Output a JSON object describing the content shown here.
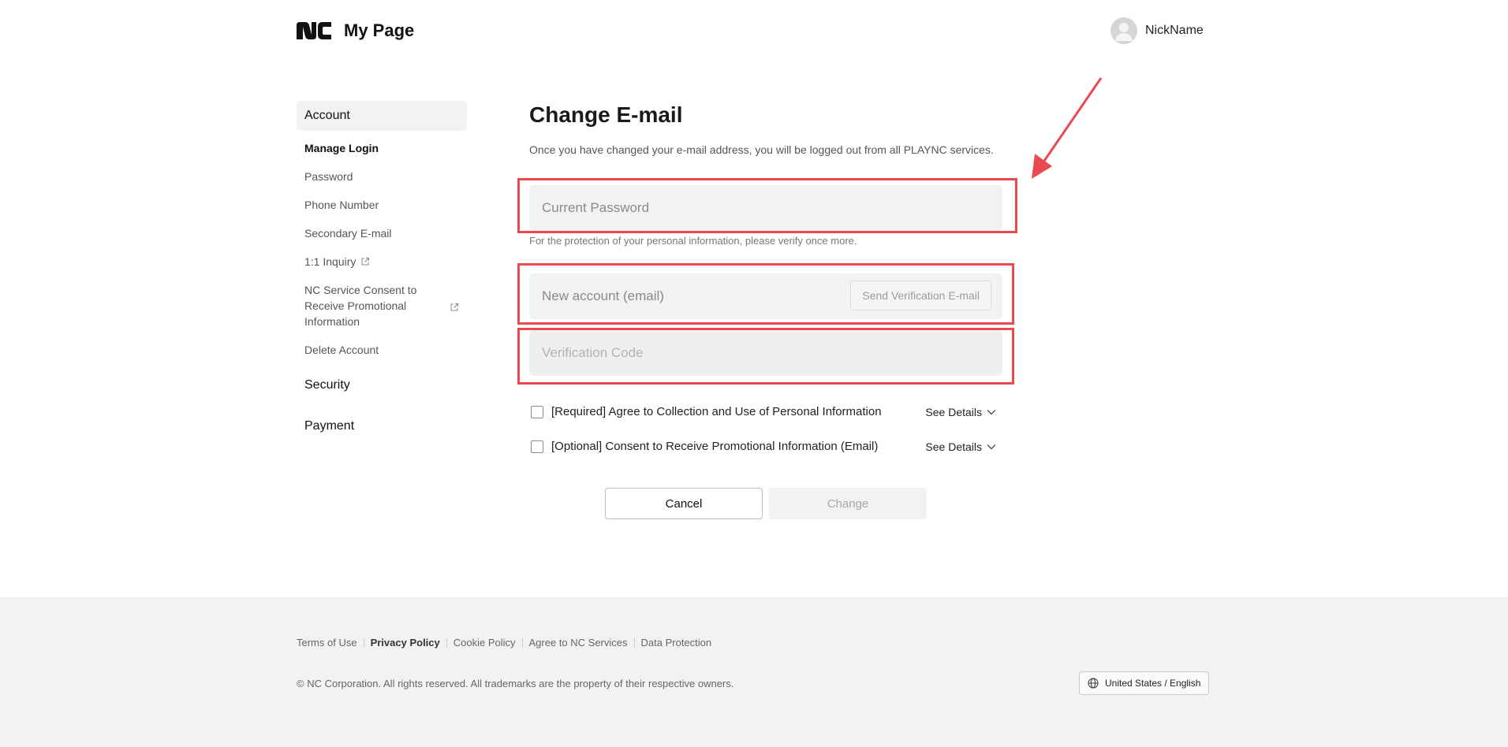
{
  "header": {
    "logo_text": "nc",
    "title": "My Page",
    "user_name": "NickName"
  },
  "sidebar": {
    "account": "Account",
    "items": [
      {
        "label": "Manage Login",
        "bold": true
      },
      {
        "label": "Password"
      },
      {
        "label": "Phone Number"
      },
      {
        "label": "Secondary E-mail"
      },
      {
        "label": "1:1 Inquiry",
        "external": true
      },
      {
        "label": "NC Service Consent to Receive Promotional Information",
        "external": true
      },
      {
        "label": "Delete Account"
      }
    ],
    "sections": [
      "Security",
      "Payment"
    ]
  },
  "main": {
    "title": "Change E-mail",
    "description": "Once you have changed your e-mail address, you will be logged out from all PLAYNC services.",
    "current_password_placeholder": "Current Password",
    "password_hint": "For the protection of your personal information, please verify once more.",
    "new_email_placeholder": "New account (email)",
    "send_verification_label": "Send Verification E-mail",
    "verification_code_placeholder": "Verification Code",
    "agreements": [
      {
        "label": "[Required] Agree to Collection and Use of Personal Information",
        "details": "See Details",
        "checked": false
      },
      {
        "label": "[Optional] Consent to Receive Promotional Information (Email)",
        "details": "See Details",
        "checked": false
      }
    ],
    "cancel_label": "Cancel",
    "change_label": "Change"
  },
  "footer": {
    "links": [
      {
        "label": "Terms of Use",
        "bold": false
      },
      {
        "label": "Privacy Policy",
        "bold": true
      },
      {
        "label": "Cookie Policy",
        "bold": false
      },
      {
        "label": "Agree to NC Services",
        "bold": false
      },
      {
        "label": "Data Protection",
        "bold": false
      }
    ],
    "copyright": "© NC Corporation. All rights reserved. All trademarks are the property of their respective owners.",
    "language": "United States / English"
  },
  "colors": {
    "highlight": "#ea4a4f",
    "footer_bg": "#f2f2f2",
    "field_bg": "#f2f2f2"
  }
}
